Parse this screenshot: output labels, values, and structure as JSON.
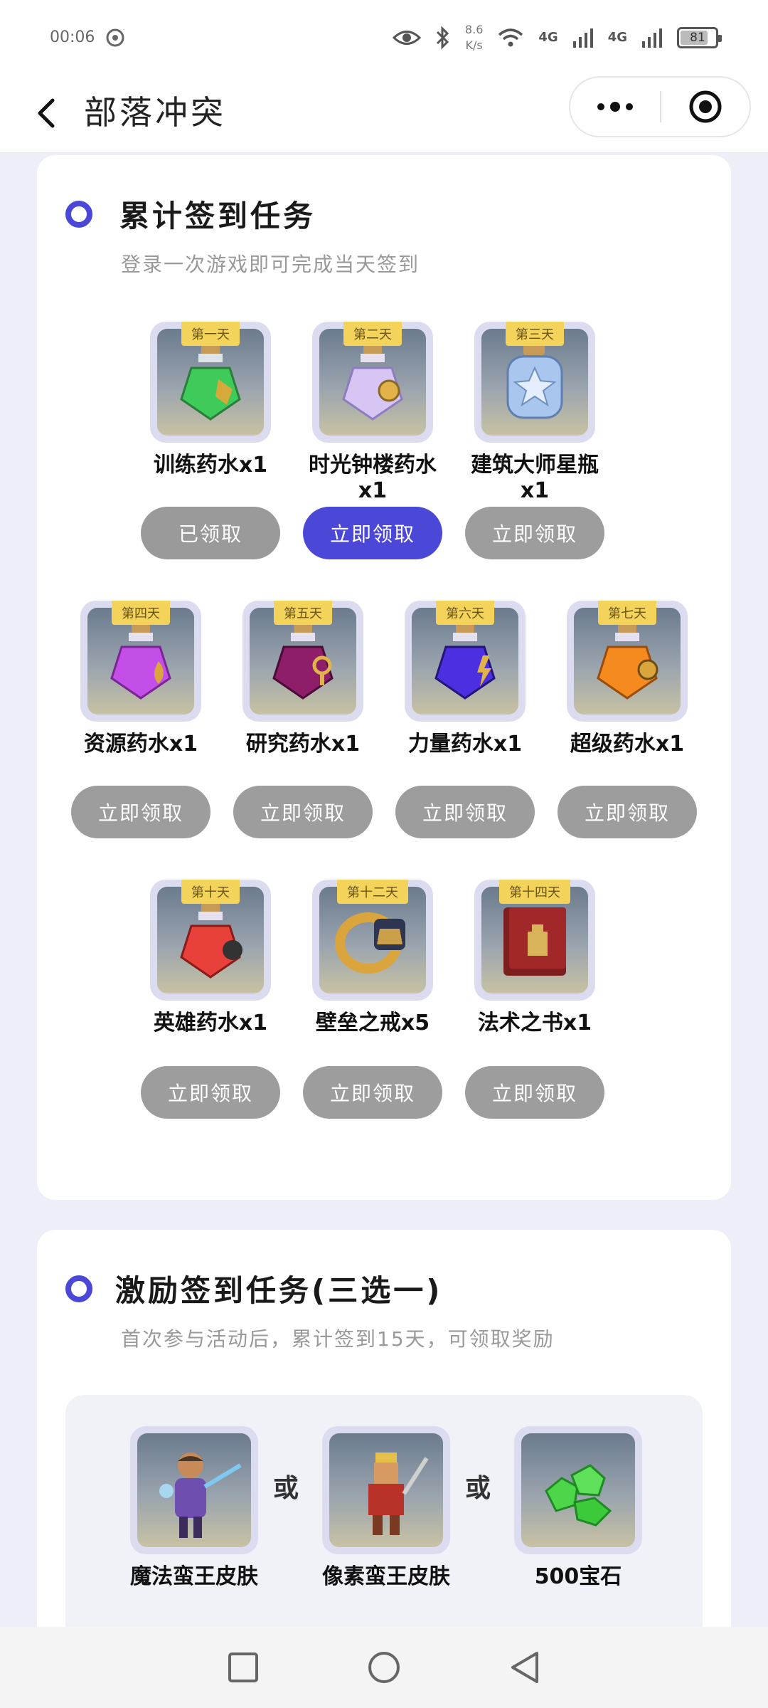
{
  "status_bar": {
    "time": "00:06",
    "net_speed_value": "8.6",
    "net_speed_unit": "K/s",
    "signal1": "4G",
    "signal2": "4G",
    "battery": "81"
  },
  "nav": {
    "title": "部落冲突"
  },
  "cumulative": {
    "title": "累计签到任务",
    "subtitle": "登录一次游戏即可完成当天签到",
    "items": [
      {
        "day": "第一天",
        "name": "训练药水x1",
        "button": "已领取",
        "state": "claimed"
      },
      {
        "day": "第二天",
        "name": "时光钟楼药水x1",
        "button": "立即领取",
        "state": "active"
      },
      {
        "day": "第三天",
        "name": "建筑大师星瓶x1",
        "button": "立即领取",
        "state": "disabled"
      },
      {
        "day": "第四天",
        "name": "资源药水x1",
        "button": "立即领取",
        "state": "disabled"
      },
      {
        "day": "第五天",
        "name": "研究药水x1",
        "button": "立即领取",
        "state": "disabled"
      },
      {
        "day": "第六天",
        "name": "力量药水x1",
        "button": "立即领取",
        "state": "disabled"
      },
      {
        "day": "第七天",
        "name": "超级药水x1",
        "button": "立即领取",
        "state": "disabled"
      },
      {
        "day": "第十天",
        "name": "英雄药水x1",
        "button": "立即领取",
        "state": "disabled"
      },
      {
        "day": "第十二天",
        "name": "壁垒之戒x5",
        "button": "立即领取",
        "state": "disabled"
      },
      {
        "day": "第十四天",
        "name": "法术之书x1",
        "button": "立即领取",
        "state": "disabled"
      }
    ]
  },
  "incentive": {
    "title": "激励签到任务(三选一)",
    "subtitle": "首次参与活动后，累计签到15天，可领取奖励",
    "or_label": "或",
    "choices": [
      {
        "name": "魔法蛮王皮肤"
      },
      {
        "name": "像素蛮王皮肤"
      },
      {
        "name": "500宝石"
      }
    ]
  },
  "colors": {
    "accent": "#4b48d8",
    "button_disabled": "#9d9d9d",
    "day_tag": "#f4d35a"
  }
}
